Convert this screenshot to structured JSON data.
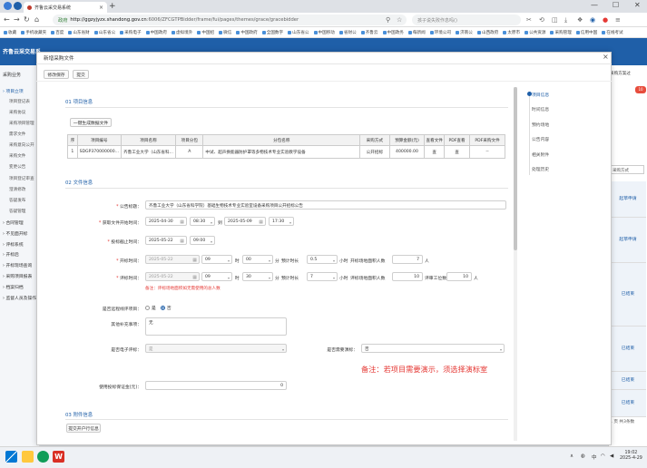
{
  "browser": {
    "tab_title": "齐鲁云采交易系统",
    "url_secure": "政府",
    "url_host": "http://ggzyjyzx.shandong.gov.cn",
    "url_path": ":6006/ZFCGTPBidder/frame/fui/pages/themes/grace/gracebidder",
    "search_placeholder": "孩子说失败作息吗()",
    "bookmarks": [
      "收藏",
      "手机收藏夹",
      "百度",
      "山东省财",
      "山东省公",
      "采购电子",
      "中国政府",
      "虚拟境外",
      "中国招",
      "微信",
      "中国政府",
      "全国数字",
      "山东省公",
      "中国移动",
      "省财公",
      "齐鲁云",
      "中国政务",
      "每新闻",
      "环境公司",
      "济南公",
      "山西政府",
      "太原市",
      "公共资源",
      "采购管理",
      "信用中国",
      "在线考试"
    ]
  },
  "app": {
    "logo": "齐鲁云采交易系",
    "left_section": "采购业务",
    "left_menu": [
      {
        "type": "sec",
        "label": "项目立项"
      },
      {
        "type": "item",
        "label": "项目登记表"
      },
      {
        "type": "item",
        "label": "采购协议"
      },
      {
        "type": "item",
        "label": "采购项目管理"
      },
      {
        "type": "item",
        "label": "需求文件"
      },
      {
        "type": "item",
        "label": "采购意向公开"
      },
      {
        "type": "item",
        "label": "采购文件"
      },
      {
        "type": "item",
        "label": "变更公告"
      },
      {
        "type": "item",
        "label": "项目登记审查"
      },
      {
        "type": "item",
        "label": "澄清修改"
      },
      {
        "type": "item",
        "label": "答疑发布"
      },
      {
        "type": "item",
        "label": "答疑管理"
      },
      {
        "type": "grp",
        "label": "合同管理"
      },
      {
        "type": "grp",
        "label": "不见面开标"
      },
      {
        "type": "grp",
        "label": "评标系统"
      },
      {
        "type": "grp",
        "label": "开标后"
      },
      {
        "type": "grp",
        "label": "开标现场查询"
      },
      {
        "type": "grp",
        "label": "采购项目报表"
      },
      {
        "type": "grp",
        "label": "档案归档"
      },
      {
        "type": "grp",
        "label": "监督人员及操作"
      }
    ],
    "right": {
      "tab": "采购方案过",
      "badge": "10",
      "select": "采购方式",
      "rows": [
        "起草申请",
        "起草申请",
        "已结束",
        "已结束",
        "已结束",
        "已结束"
      ],
      "footer": "1  页  共3条数"
    }
  },
  "modal": {
    "title": "新增采购文件",
    "buttons": [
      "修改保存",
      "提交"
    ],
    "section1": "01  项目信息",
    "section2": "02  文件信息",
    "section3": "03  附件信息",
    "gen_button": "一键生成数据文件",
    "attach_button": "提交开户行信息",
    "table": {
      "headers": [
        "序",
        "项目编号",
        "项目名称",
        "项目分包",
        "分包名称",
        "采购方式",
        "预算金额(元)",
        "查看文件",
        "PDF查看",
        "PDF采购文件"
      ],
      "rows": [
        [
          "1",
          "SDGP370000000...",
          "齐鲁工业大学（山东省科...",
          "A",
          "中试、超声换能器防护罩等多物技术专业实验教学设备",
          "公开招标",
          "400000.00",
          "查",
          "查",
          "--"
        ]
      ]
    },
    "form": {
      "notice_title_label": "公告标题：",
      "notice_title_value": "齐鲁工业大学（山东省科学院）基础生物技术专业实验室设备采购项目公开招标公告",
      "doc_time_label": "获取文件开始时间：",
      "doc_start_date": "2025-04-30",
      "doc_start_time": "08:30",
      "doc_to": "到",
      "doc_end_date": "2025-05-09",
      "doc_end_time": "17:30",
      "bid_deadline_label": "投标截止时间：",
      "bid_deadline_date": "2025-05-22",
      "bid_deadline_time": "09:00",
      "open_time_label": "开标时间：",
      "open_date": "2025-05-22",
      "open_hour": "09",
      "open_min": "00",
      "hour_unit": "时",
      "min_unit": "分",
      "duration_label": "预计时长",
      "open_duration": "0.5",
      "hour_unit2": "小时",
      "open_people_label": "开标场地面积人数",
      "open_people": "7",
      "person_unit": "人",
      "eval_time_label": "评标时间：",
      "eval_date": "2025-05-22",
      "eval_hour": "09",
      "eval_min": "30",
      "eval_duration": "7",
      "eval_people_label": "评标场地面积人数",
      "eval_people": "10",
      "expert_label": "评审工位数",
      "expert_count": "10",
      "warning": "备注：评标场地面积如无需使用的总人数",
      "online_label": "是否远程线评项目：",
      "online_yes": "是",
      "online_no": "否",
      "remark_label": "其他补充事项：",
      "remark_value": "无",
      "eval_method_label": "是否电子评标：",
      "eval_method_value": "是",
      "demo_label": "是否需要演标：",
      "demo_value": "否",
      "demo_note": "备注：若项目需要演示，须选择演标室",
      "deposit_label": "使用投标保证金(元)：",
      "deposit_value": "0"
    },
    "anchors": [
      "项目信息",
      "时间信息",
      "预约场地",
      "公告内容",
      "相关附件",
      "处理历史"
    ]
  },
  "taskbar": {
    "time": "19:02",
    "date": "2025-4-29",
    "ime": "中"
  }
}
